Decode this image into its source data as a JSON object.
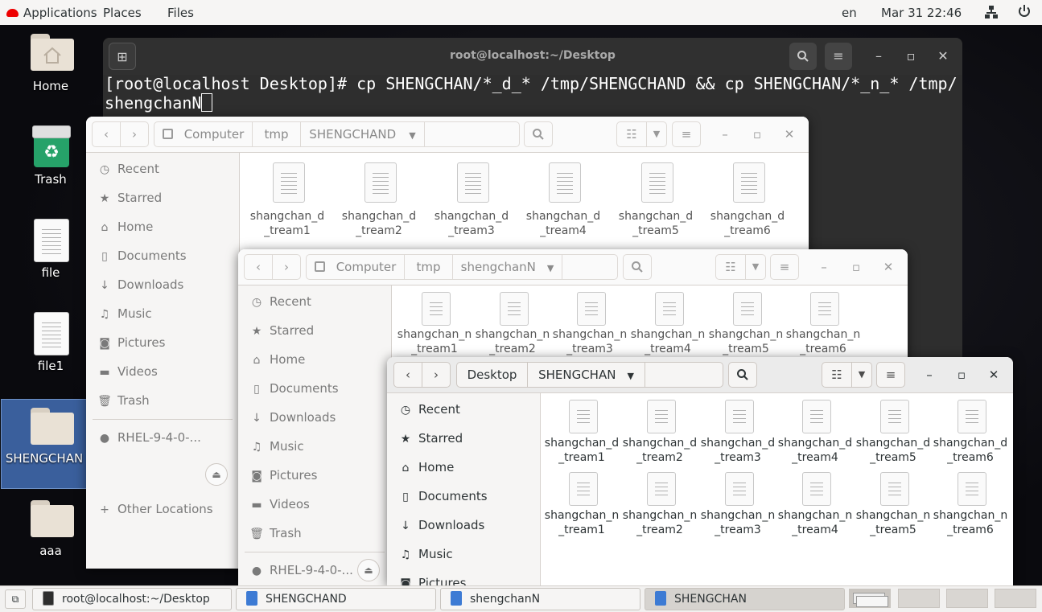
{
  "topbar": {
    "applications": "Applications",
    "places": "Places",
    "files": "Files",
    "language": "en",
    "clock": "Mar 31 22:46",
    "network_icon": "network-wired-icon",
    "power_icon": "power-icon"
  },
  "desktop": {
    "icons": [
      {
        "label": "Home",
        "type": "home-folder"
      },
      {
        "label": "Trash",
        "type": "trash"
      },
      {
        "label": "file",
        "type": "document"
      },
      {
        "label": "file1",
        "type": "document"
      },
      {
        "label": "SHENGCHAN",
        "type": "folder"
      },
      {
        "label": "aaa",
        "type": "folder"
      }
    ]
  },
  "terminal": {
    "title": "root@localhost:~/Desktop",
    "command": "[root@localhost Desktop]# cp SHENGCHAN/*_d_* /tmp/SHENGCHAND && cp SHENGCHAN/*_n_* /tmp/shengchanN"
  },
  "sidebar": {
    "recent": "Recent",
    "starred": "Starred",
    "home": "Home",
    "documents": "Documents",
    "downloads": "Downloads",
    "music": "Music",
    "pictures": "Pictures",
    "videos": "Videos",
    "trash": "Trash",
    "device": "RHEL-9-4-0-...",
    "other": "Other Locations"
  },
  "win1": {
    "crumbs": [
      "Computer",
      "tmp",
      "SHENGCHAND"
    ],
    "files": [
      "shangchan_d_tream1",
      "shangchan_d_tream2",
      "shangchan_d_tream3",
      "shangchan_d_tream4",
      "shangchan_d_tream5",
      "shangchan_d_tream6"
    ]
  },
  "win2": {
    "crumbs": [
      "Computer",
      "tmp",
      "shengchanN"
    ],
    "files": [
      "shangchan_n_tream1",
      "shangchan_n_tream2",
      "shangchan_n_tream3",
      "shangchan_n_tream4",
      "shangchan_n_tream5",
      "shangchan_n_tream6"
    ]
  },
  "win3": {
    "crumbs": [
      "Desktop",
      "SHENGCHAN"
    ],
    "files_d": [
      "shangchan_d_tream1",
      "shangchan_d_tream2",
      "shangchan_d_tream3",
      "shangchan_d_tream4",
      "shangchan_d_tream5",
      "shangchan_d_tream6"
    ],
    "files_n": [
      "shangchan_n_tream1",
      "shangchan_n_tream2",
      "shangchan_n_tream3",
      "shangchan_n_tream4",
      "shangchan_n_tream5",
      "shangchan_n_tream6"
    ],
    "sidebar_cut": "Pictures"
  },
  "taskbar": {
    "items": [
      "root@localhost:~/Desktop",
      "SHENGCHAND",
      "shengchanN",
      "SHENGCHAN"
    ]
  },
  "colors": {
    "selection": "#3a5f9c",
    "terminal_bg": "#2e2e2e",
    "folder": "#e9e1d5"
  }
}
